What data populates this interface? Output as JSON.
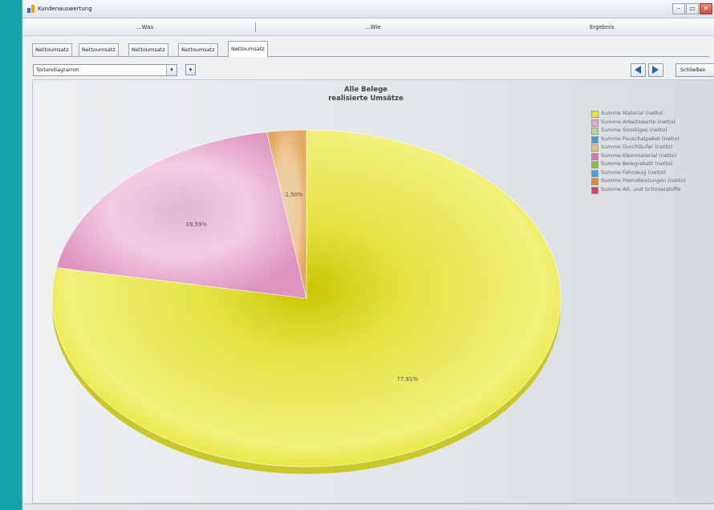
{
  "window": {
    "title": "Kundenauswertung",
    "buttons": [
      "–",
      "▭",
      "✕"
    ]
  },
  "steps": {
    "was": "...Was",
    "wie": "...Wie",
    "ergebnis": "Ergebnis"
  },
  "tabs": [
    "Nettoumsatz",
    "Nettoumsatz",
    "Nettoumsatz",
    "Nettoumsatz",
    "Nettoumsatz"
  ],
  "toolbar": {
    "chart_type": "Tortendiagramm",
    "close_label": "Schließen"
  },
  "chart_data": {
    "type": "pie",
    "title": "Alle Belege",
    "subtitle": "realisierte Umsätze",
    "slices": [
      {
        "name": "Summe Material (netto)",
        "value": 77.91,
        "label": "77,91%",
        "color": "#e8e634"
      },
      {
        "name": "Summe Arbeitswerte (netto)",
        "value": 19.59,
        "label": "19,59%",
        "color": "#e6a8cc"
      },
      {
        "name": "Summe Sonstiges (netto)",
        "value": 0,
        "label": "",
        "color": "#b7d79a"
      },
      {
        "name": "Summe Pauschalpaket (netto)",
        "value": 0,
        "label": "",
        "color": "#4a9ac8"
      },
      {
        "name": "Summe Durchläufer (netto)",
        "value": 2.5,
        "label": "2,50%",
        "color": "#e9be86"
      },
      {
        "name": "Summe Kleinmaterial (netto)",
        "value": 0,
        "label": "",
        "color": "#d975b3"
      },
      {
        "name": "Summe Belegrabatt (netto)",
        "value": 0,
        "label": "",
        "color": "#8cc04e"
      },
      {
        "name": "Summe Fahrzeug (netto)",
        "value": 0,
        "label": "",
        "color": "#4a9ee6"
      },
      {
        "name": "Summe Fremdleistungen (netto)",
        "value": 0,
        "label": "",
        "color": "#e48a3a"
      },
      {
        "name": "Summe Alt- und Schmierstoffe",
        "value": 0,
        "label": "",
        "color": "#d3426e"
      }
    ],
    "start_angle_deg": 0,
    "legend_position": "right"
  }
}
